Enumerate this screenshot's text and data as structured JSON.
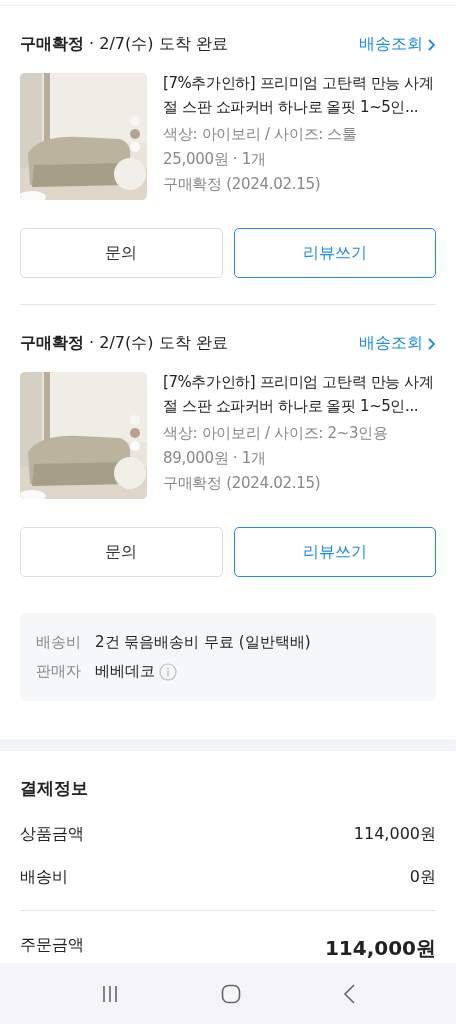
{
  "orders": [
    {
      "status": "구매확정",
      "arrival": " · 2/7(수) 도착 완료",
      "track_link": "배송조회",
      "product": {
        "kind": "picture",
        "name": "[7%추가인하] 프리미엄 고탄력 만능 사계절 스판 쇼파커버 하나로 올핏 1~5인...",
        "option": "색상: 아이보리 / 사이즈: 스툴",
        "price": "25,000원 · 1개",
        "confirm": "구매확정 (2024.02.15)"
      },
      "buttons": [
        {
          "label": "문의",
          "primary": false
        },
        {
          "label": "리뷰쓰기",
          "primary": true
        }
      ]
    },
    {
      "status": "구매확정",
      "arrival": " · 2/7(수) 도착 완료",
      "track_link": "배송조회",
      "product": {
        "kind": "picture",
        "name": "[7%추가인하] 프리미엄 고탄력 만능 사계절 스판 쇼파커버 하나로 올핏 1~5인...",
        "option": "색상: 아이보리 / 사이즈: 2~3인용",
        "price": "89,000원 · 1개",
        "confirm": "구매확정 (2024.02.15)"
      },
      "buttons": [
        {
          "label": "문의",
          "primary": false
        },
        {
          "label": "리뷰쓰기",
          "primary": true
        }
      ]
    }
  ],
  "shipping_info": [
    {
      "label": "배송비",
      "value": "2건 묶음배송비 무료 (일반택배)",
      "info": false
    },
    {
      "label": "판매자",
      "value": "베베데코",
      "info": true
    }
  ],
  "payment": {
    "title": "결제정보",
    "rows": [
      {
        "label": "상품금액",
        "value": "114,000원"
      },
      {
        "label": "배송비",
        "value": "0원"
      }
    ],
    "total": {
      "label": "주문금액",
      "value": "114,000원"
    }
  }
}
